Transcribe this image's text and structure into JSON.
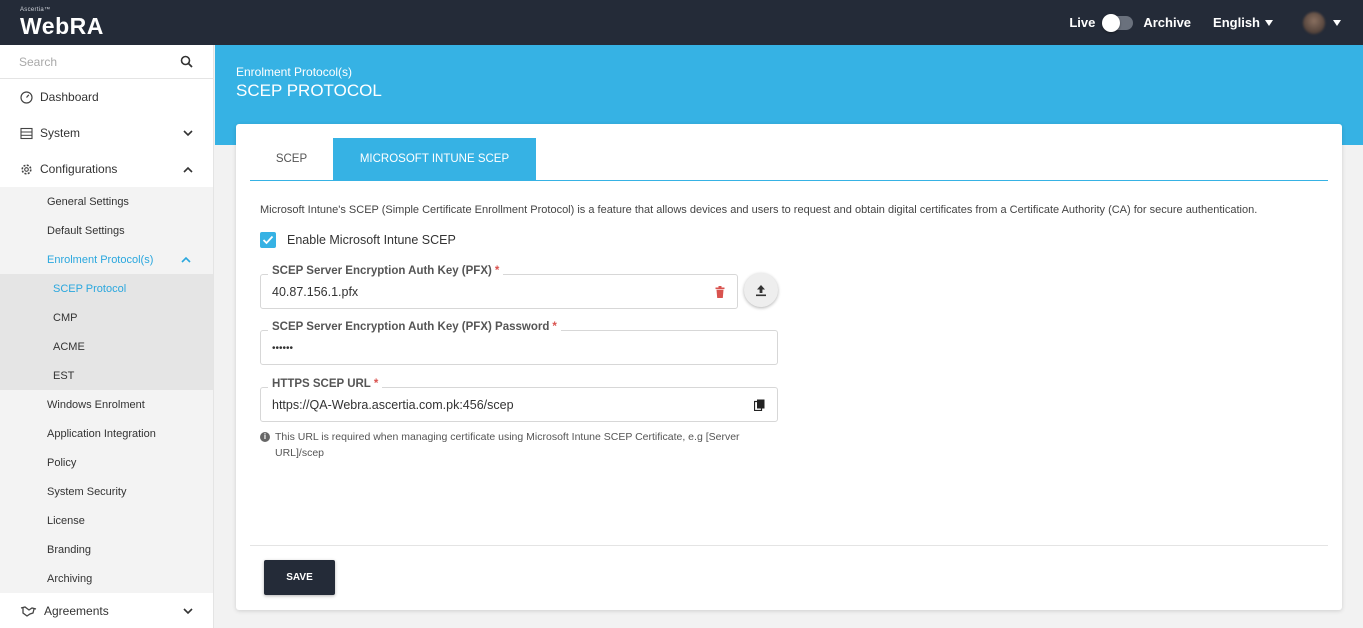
{
  "brand": {
    "small": "Ascertia™",
    "name": "WebRA"
  },
  "topbar": {
    "live_label": "Live",
    "archive_label": "Archive",
    "language": "English"
  },
  "sidebar": {
    "search_placeholder": "Search",
    "dashboard": "Dashboard",
    "system": "System",
    "configurations": "Configurations",
    "config_items": {
      "general": "General Settings",
      "default": "Default Settings",
      "enrolment": "Enrolment Protocol(s)",
      "windows": "Windows Enrolment",
      "application": "Application Integration",
      "policy": "Policy",
      "security": "System Security",
      "license": "License",
      "branding": "Branding",
      "archiving": "Archiving"
    },
    "protocols": [
      "SCEP Protocol",
      "CMP",
      "ACME",
      "EST"
    ],
    "agreements": "Agreements"
  },
  "header": {
    "breadcrumb": "Enrolment Protocol(s)",
    "title": "SCEP PROTOCOL"
  },
  "tabs": [
    "SCEP",
    "MICROSOFT INTUNE SCEP"
  ],
  "form": {
    "description": "Microsoft Intune's SCEP (Simple Certificate Enrollment Protocol) is a feature that allows devices and users to request and obtain digital certificates from a Certificate Authority (CA) for secure authentication.",
    "enable_label": "Enable Microsoft Intune SCEP",
    "enable_checked": true,
    "pfx_label": "SCEP Server Encryption Auth Key (PFX)",
    "pfx_value": "40.87.156.1.pfx",
    "password_label": "SCEP Server Encryption Auth Key (PFX) Password",
    "password_value": "••••••",
    "url_label": "HTTPS SCEP URL",
    "url_value": "https://QA-Webra.ascertia.com.pk:456/scep",
    "required_mark": "*",
    "hint": "This URL is required when managing certificate using Microsoft Intune SCEP Certificate, e.g [Server URL]/scep",
    "save_label": "SAVE"
  },
  "colors": {
    "accent": "#36b2e4",
    "dark": "#242b38",
    "danger": "#d9534f"
  }
}
